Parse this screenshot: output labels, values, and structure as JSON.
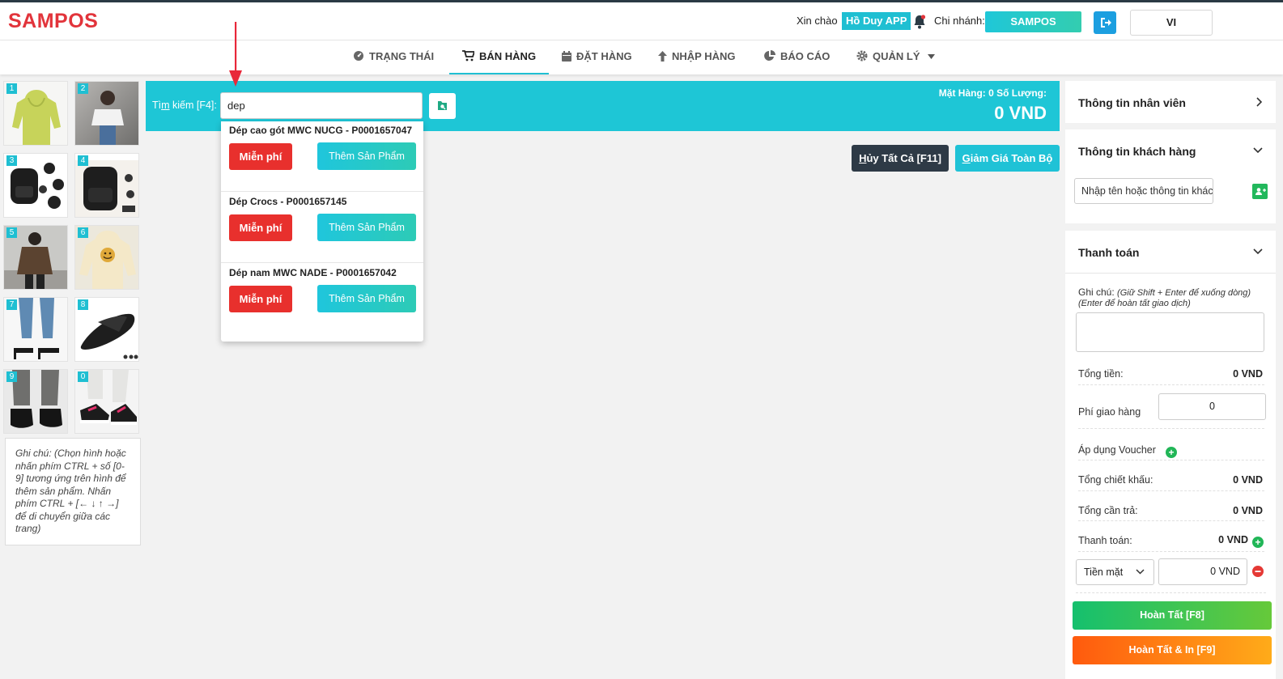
{
  "header": {
    "logo": "SAMPOS",
    "greeting": "Xin chào",
    "user": "Hồ Duy APP",
    "branch_label": "Chi nhánh:",
    "branch": "SAMPOS",
    "language": "VI"
  },
  "nav": [
    {
      "label": "TRẠNG THÁI",
      "icon": "dashboard-icon"
    },
    {
      "label": "BÁN HÀNG",
      "icon": "cart-icon"
    },
    {
      "label": "ĐẶT HÀNG",
      "icon": "calendar-icon"
    },
    {
      "label": "NHẬP HÀNG",
      "icon": "arrow-up-icon"
    },
    {
      "label": "BÁO CÁO",
      "icon": "pie-chart-icon"
    },
    {
      "label": "QUẢN LÝ",
      "icon": "gear-icon"
    }
  ],
  "products": [
    {
      "num": "1",
      "name": "green hoodie"
    },
    {
      "num": "2",
      "name": "girl in t-shirt"
    },
    {
      "num": "3",
      "name": "black backpack"
    },
    {
      "num": "4",
      "name": "backpack set"
    },
    {
      "num": "5",
      "name": "man in brown jacket"
    },
    {
      "num": "6",
      "name": "smiley hoodie"
    },
    {
      "num": "7",
      "name": "heeled sandals"
    },
    {
      "num": "8",
      "name": "black slide"
    },
    {
      "num": "9",
      "name": "loafers"
    },
    {
      "num": "0",
      "name": "sneakers"
    }
  ],
  "left_note": "Ghi chú: (Chọn hình hoặc nhấn phím CTRL + số [0-9] tương ứng trên hình để thêm sản phẩm. Nhấn phím CTRL + [← ↓ ↑ →] để di chuyển giữa các trang)",
  "search": {
    "label_prefix": "Tì",
    "label_underline": "m",
    "label_suffix": " kiếm [F4]:",
    "value": "dep",
    "summary": "Mặt Hàng:  0  Số Lượng:",
    "total": "0 VND"
  },
  "actions": {
    "cancel_all_underline": "H",
    "cancel_all_rest": "ủy Tất Cả [F11]",
    "discount_all_underline": "G",
    "discount_all_rest": "iảm Giá Toàn Bộ"
  },
  "results": [
    {
      "title": "Dép cao gót MWC NUCG - P0001657047",
      "free": "Miễn phí",
      "add": "Thêm Sản Phẩm"
    },
    {
      "title": "Dép Crocs - P0001657145",
      "free": "Miễn phí",
      "add": "Thêm Sản Phẩm"
    },
    {
      "title": "Dép nam MWC NADE - P0001657042",
      "free": "Miễn phí",
      "add": "Thêm Sản Phẩm"
    }
  ],
  "right": {
    "staff_title": "Thông tin nhân viên",
    "customer_title": "Thông tin khách hàng",
    "customer_placeholder": "Nhập tên hoặc thông tin khác",
    "payment_title": "Thanh toán",
    "note_label": "Ghi chú:",
    "note_hint": "(Giữ Shift + Enter để xuống dòng)",
    "note_hint2": "(Enter để hoàn tất giao dịch)",
    "total_label": "Tổng tiền:",
    "total_value": "0 VND",
    "shipping_label": "Phí giao hàng",
    "shipping_value": "0",
    "voucher_label": "Áp dụng Voucher",
    "discount_label": "Tổng chiết khấu:",
    "discount_value": "0 VND",
    "due_label": "Tổng cần trả:",
    "due_value": "0 VND",
    "paid_label": "Thanh toán:",
    "paid_value": "0 VND",
    "method": "Tiền mặt",
    "method_amount": "0  VND",
    "finish": "Hoàn Tất [F8]",
    "finish_print": "Hoàn Tất & In [F9]"
  },
  "colors": {
    "accent": "#1ec6d6",
    "brand": "#e2343b",
    "danger": "#e8302d",
    "dark": "#2e3a46"
  }
}
